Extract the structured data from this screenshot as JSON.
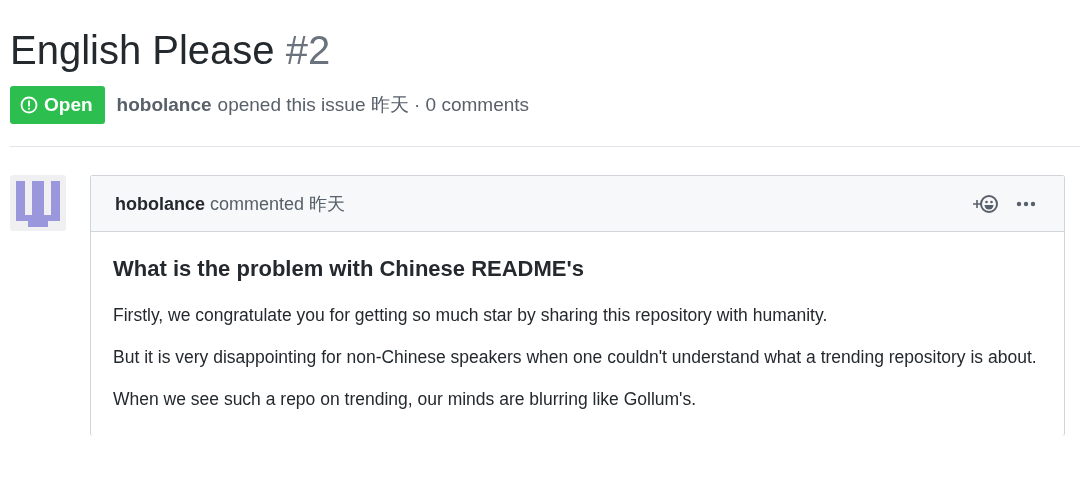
{
  "issue": {
    "title": "English Please",
    "number": "#2"
  },
  "status": {
    "kind": "open",
    "label": "Open"
  },
  "meta": {
    "author": "hobolance",
    "text": "opened this issue 昨天 · 0 comments"
  },
  "comment": {
    "author": "hobolance",
    "action": "commented 昨天",
    "heading": "What is the problem with Chinese README's",
    "paragraphs": [
      "Firstly, we congratulate you for getting so much star by sharing this repository with humanity.",
      "But it is very disappointing for non-Chinese speakers when one couldn't understand what a trending repository is about.",
      "When we see such a repo on trending, our minds are blurring like Gollum's."
    ]
  }
}
